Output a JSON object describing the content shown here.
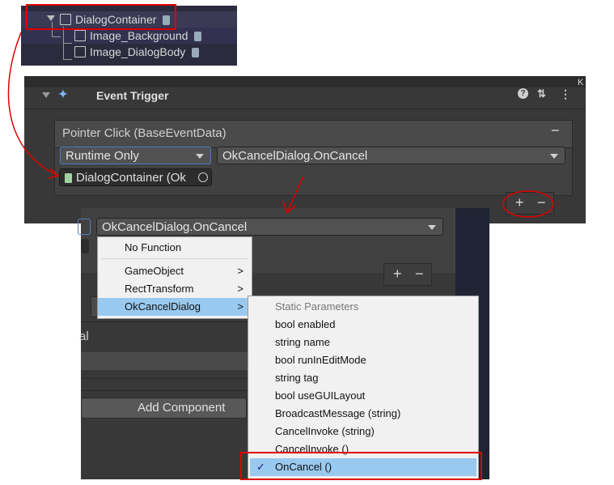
{
  "hierarchy": {
    "items": [
      {
        "label": "DialogContainer"
      },
      {
        "label": "Image_Background"
      },
      {
        "label": "Image_DialogBody"
      }
    ]
  },
  "inspector": {
    "component_title": "Event Trigger",
    "event_entry": "Pointer Click (BaseEventData)",
    "runtime_select": "Runtime Only",
    "function_select": "OkCancelDialog.OnCancel",
    "target_object": "DialogContainer (Ok",
    "add_symbol": "+",
    "remove_symbol": "−",
    "partial_right_text": "K"
  },
  "lower_panel": {
    "function_select": "OkCancelDialog.OnCancel",
    "label_fragment": "al",
    "add_component": "Add Component",
    "add_symbol": "+",
    "remove_symbol": "−"
  },
  "context_menu": {
    "items": [
      {
        "label": "No Function"
      },
      {
        "label": "GameObject",
        "submenu": ">"
      },
      {
        "label": "RectTransform",
        "submenu": ">"
      },
      {
        "label": "OkCancelDialog",
        "submenu": ">"
      }
    ]
  },
  "submenu": {
    "items": [
      {
        "label": "Static Parameters"
      },
      {
        "label": "bool enabled"
      },
      {
        "label": "string name"
      },
      {
        "label": "bool runInEditMode"
      },
      {
        "label": "string tag"
      },
      {
        "label": "bool useGUILayout"
      },
      {
        "label": "BroadcastMessage (string)"
      },
      {
        "label": "CancelInvoke (string)"
      },
      {
        "label": "CancelInvoke ()"
      },
      {
        "label": "OnCancel ()",
        "check": "✓"
      }
    ]
  },
  "colors": {
    "annotation_red": "#e00000",
    "menu_highlight": "#99c9ef"
  }
}
